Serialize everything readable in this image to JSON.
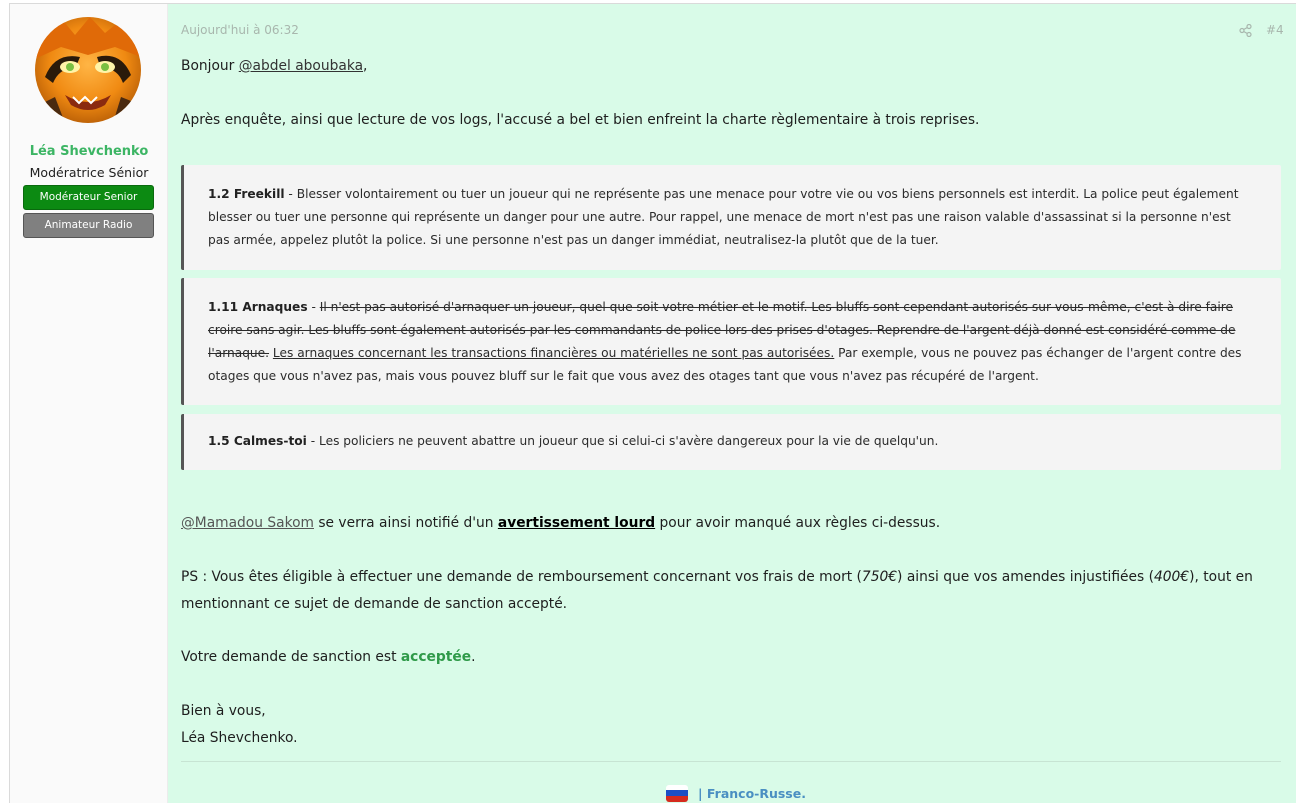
{
  "user": {
    "name": "Léa Shevchenko",
    "title": "Modératrice Sénior",
    "badges": [
      "Modérateur Senior",
      "Animateur Radio"
    ]
  },
  "post": {
    "date": "Aujourd'hui à 06:32",
    "number": "#4",
    "greeting_prefix": "Bonjour ",
    "greeting_mention": "@abdel aboubaka",
    "greeting_suffix": ",",
    "intro": "Après enquête, ainsi que lecture de vos logs, l'accusé a bel et bien enfreint la charte règlementaire à trois reprises.",
    "rules": [
      {
        "title": "1.2 Freekill",
        "text": " - Blesser volontairement ou tuer un joueur qui ne représente pas une menace pour votre vie ou vos biens personnels est interdit. La police peut également blesser ou tuer une personne qui représente un danger pour une autre. Pour rappel, une menace de mort n'est pas une raison valable d'assassinat si la personne n'est pas armée, appelez plutôt la police. Si une personne n'est pas un danger immédiat, neutralisez-la plutôt que de la tuer."
      },
      {
        "title": "1.11 Arnaques",
        "dash": " - ",
        "strike": "Il n'est pas autorisé d'arnaquer un joueur, quel que soit votre métier et le motif. Les bluffs sont cependant autorisés sur vous-même, c'est à dire faire croire sans agir. Les bluffs sont également autorisés par les commandants de police lors des prises d'otages. Reprendre de l'argent déjà donné est considéré comme de l'arnaque.",
        "underline": "Les arnaques concernant les transactions financières ou matérielles ne sont pas autorisées.",
        "rest": " Par exemple, vous ne pouvez pas échanger de l'argent contre des otages que vous n'avez pas, mais vous pouvez bluff sur le fait que vous avez des otages tant que vous n'avez pas récupéré de l'argent."
      },
      {
        "title": "1.5 Calmes-toi",
        "text": " - Les policiers ne peuvent abattre un joueur que si celui-ci s'avère dangereux pour la vie de quelqu'un."
      }
    ],
    "verdict_mention": "@Mamadou Sakom",
    "verdict_mid": " se verra ainsi notifié d'un ",
    "verdict_strong": "avertissement lourd",
    "verdict_end": " pour avoir manqué aux règles ci-dessus.",
    "ps_1": "PS : Vous êtes éligible à effectuer une demande de remboursement concernant vos frais de mort (",
    "ps_amount1": "750€",
    "ps_2": ") ainsi que vos amendes injustifiées (",
    "ps_amount2": "400€",
    "ps_3": "), tout en mentionnant ce sujet de demande de sanction accepté.",
    "decision_prefix": "Votre demande de sanction est ",
    "decision_word": "acceptée",
    "decision_suffix": ".",
    "closing_1": "Bien à vous,",
    "closing_2": "Léa Shevchenko.",
    "signature": "|   Franco-Russe."
  },
  "colors": {
    "post_bg": "#d9fbe8",
    "username": "#3cb564",
    "badge_green": "#0c8a12",
    "badge_grey": "#808080",
    "accepted": "#2f9a49"
  }
}
